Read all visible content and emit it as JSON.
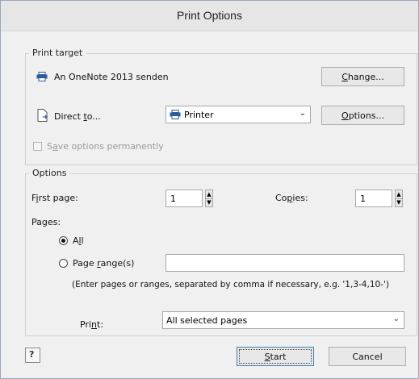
{
  "window": {
    "title": "Print Options"
  },
  "print_target": {
    "group_title": "Print target",
    "printer_icon": "printer-icon",
    "printer_name": "An OneNote 2013 senden",
    "change_button": {
      "pre": "",
      "u": "C",
      "post": "hange..."
    },
    "direct_to": {
      "pre": "Direct ",
      "u": "t",
      "post": "o..."
    },
    "direct_icon": "document-arrow-icon",
    "target_select": {
      "value": "Printer",
      "icon": "printer-icon"
    },
    "options_button": {
      "pre": "",
      "u": "O",
      "post": "ptions..."
    },
    "save_options": {
      "pre": "S",
      "u": "a",
      "post": "ve options permanently",
      "checked": false,
      "disabled": true
    }
  },
  "options": {
    "group_title": "Options",
    "first_page_label": {
      "pre": "F",
      "u": "i",
      "post": "rst page:"
    },
    "first_page_value": "1",
    "copies_label": {
      "pre": "Co",
      "u": "p",
      "post": "ies:"
    },
    "copies_value": "1",
    "pages_label": "Pages:",
    "all_radio": {
      "pre": "A",
      "u": "l",
      "post": "l",
      "selected": true
    },
    "range_radio": {
      "pre": "Page ",
      "u": "r",
      "post": "ange(s)",
      "selected": false
    },
    "range_value": "",
    "range_hint": "(Enter pages or ranges, separated by comma if necessary, e.g. '1,3-4,10-')",
    "print_label": {
      "pre": "Pri",
      "u": "n",
      "post": "t:"
    },
    "print_select": "All selected pages"
  },
  "footer": {
    "help_icon": "help-icon",
    "start_button": {
      "pre": "",
      "u": "S",
      "post": "tart"
    },
    "cancel_button": "Cancel"
  },
  "colors": {
    "accent": "#3c7fb1",
    "window_border": "#9aa6b8"
  }
}
